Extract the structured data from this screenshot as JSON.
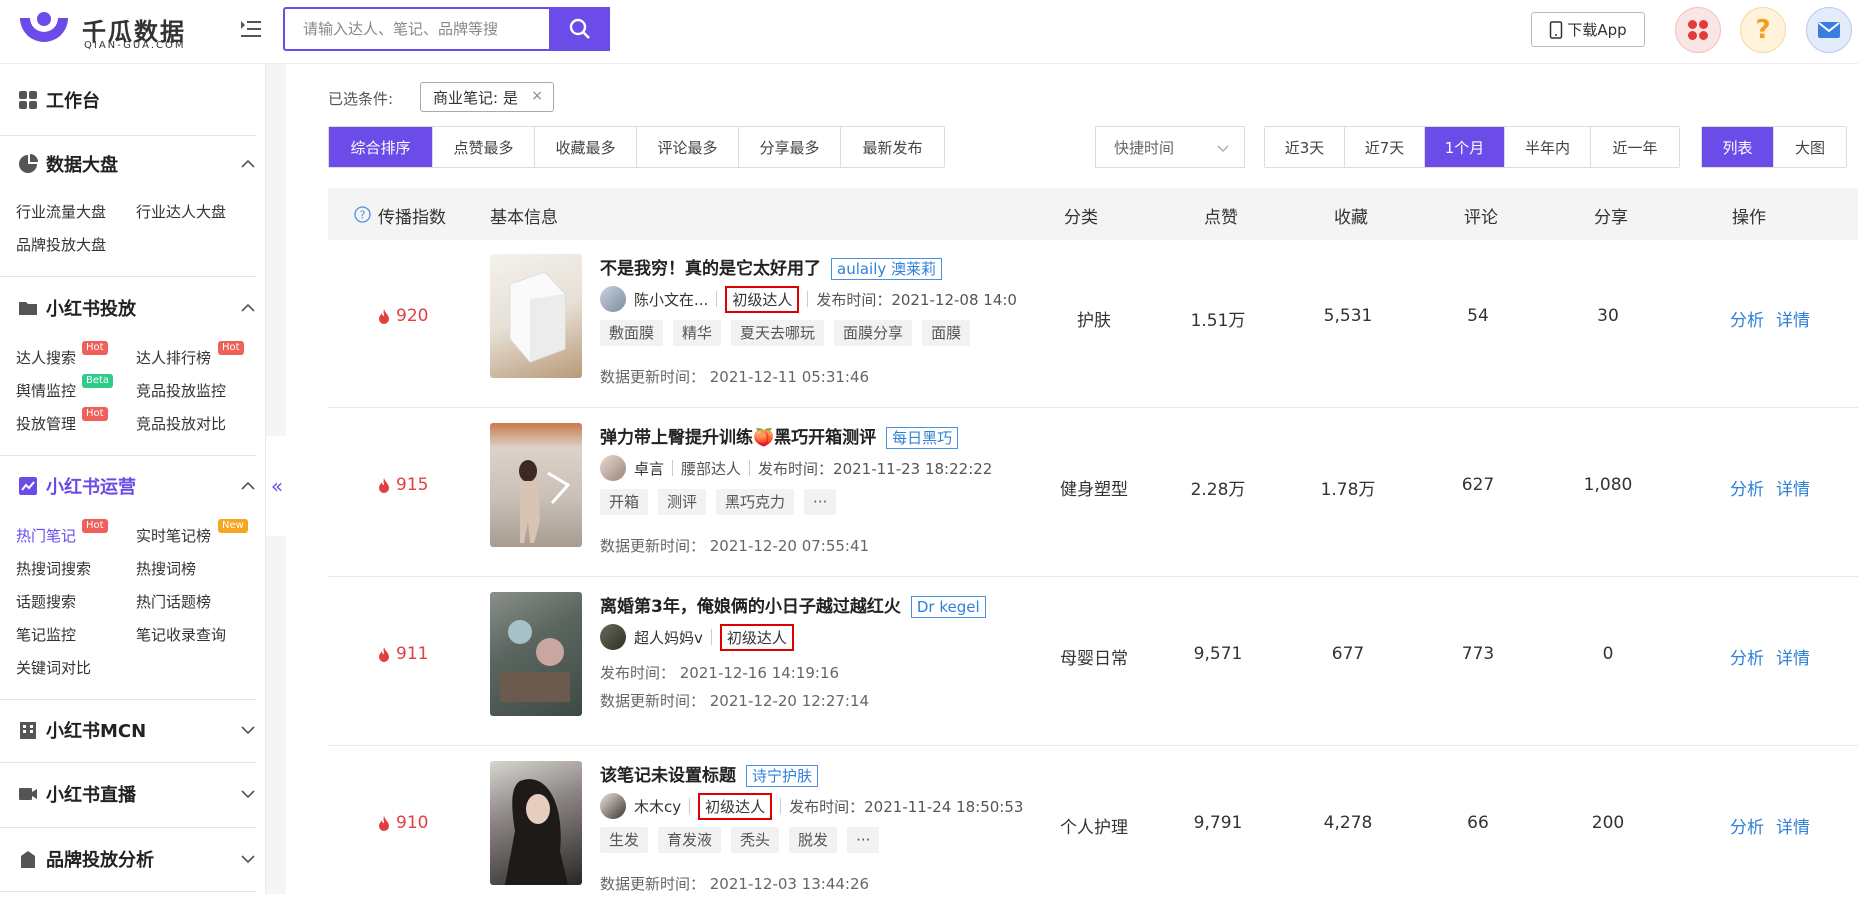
{
  "brand": {
    "name": "千瓜数据",
    "sub": "QIAN-GUA.COM",
    "color": "#6c4ce8"
  },
  "search": {
    "placeholder": "请输入达人、笔记、品牌等搜"
  },
  "header": {
    "download_label": "下载App"
  },
  "sidebar": {
    "workbench": "工作台",
    "sections": [
      {
        "title": "数据大盘",
        "items": [
          "行业流量大盘",
          "行业达人大盘",
          "品牌投放大盘"
        ]
      },
      {
        "title": "小红书投放",
        "items": [
          "达人搜索",
          "达人排行榜",
          "舆情监控",
          "竞品投放监控",
          "投放管理",
          "竞品投放对比"
        ]
      },
      {
        "title": "小红书运营",
        "items": [
          "热门笔记",
          "实时笔记榜",
          "热搜词搜索",
          "热搜词榜",
          "话题搜索",
          "热门话题榜",
          "笔记监控",
          "笔记收录查询",
          "关键词对比"
        ]
      },
      {
        "title": "小红书MCN"
      },
      {
        "title": "小红书直播"
      },
      {
        "title": "品牌投放分析"
      }
    ],
    "badges": {
      "hot": "Hot",
      "beta": "Beta",
      "new": "New"
    }
  },
  "filters": {
    "selected_label": "已选条件:",
    "selected_tag": "商业笔记: 是",
    "sort_tabs": [
      "综合排序",
      "点赞最多",
      "收藏最多",
      "评论最多",
      "分享最多",
      "最新发布"
    ],
    "sort_active": "综合排序",
    "quick_time": "快捷时间",
    "time_tabs": [
      "近3天",
      "近7天",
      "1个月",
      "半年内",
      "近一年"
    ],
    "time_active": "1个月",
    "view_tabs": [
      "列表",
      "大图"
    ],
    "view_active": "列表"
  },
  "table": {
    "headers": [
      "传播指数",
      "基本信息",
      "分类",
      "点赞",
      "收藏",
      "评论",
      "分享",
      "操作"
    ],
    "rows": [
      {
        "score": "920",
        "title": "不是我穷！真的是它太好用了",
        "brand": "aulaily 澳莱莉",
        "author": "陈小文在...",
        "level": "初级达人",
        "level_boxed": true,
        "publish": "发布时间：2021-12-08 14:0",
        "tags": [
          "敷面膜",
          "精华",
          "夏天去哪玩",
          "面膜分享",
          "面膜"
        ],
        "updated": "数据更新时间：  2021-12-11 05:31:46",
        "category": "护肤",
        "likes": "1.51万",
        "collects": "5,531",
        "comments": "54",
        "shares": "30",
        "ops": [
          "分析",
          "详情"
        ]
      },
      {
        "score": "915",
        "title": "弹力带上臀提升训练🍑黑巧开箱测评",
        "brand": "每日黑巧",
        "author": "卓言",
        "level": "腰部达人",
        "level_boxed": false,
        "publish": "发布时间：2021-11-23 18:22:22",
        "tags": [
          "开箱",
          "测评",
          "黑巧克力",
          "···"
        ],
        "updated": "数据更新时间：  2021-12-20 07:55:41",
        "category": "健身塑型",
        "likes": "2.28万",
        "collects": "1.78万",
        "comments": "627",
        "shares": "1,080",
        "ops": [
          "分析",
          "详情"
        ]
      },
      {
        "score": "911",
        "title": "离婚第3年，俺娘俩的小日子越过越红火",
        "brand": "Dr kegel",
        "author": "超人妈妈v",
        "level": "初级达人",
        "level_boxed": true,
        "publish": "发布时间：  2021-12-16 14:19:16",
        "tags": [],
        "updated": "数据更新时间：  2021-12-20 12:27:14",
        "category": "母婴日常",
        "likes": "9,571",
        "collects": "677",
        "comments": "773",
        "shares": "0",
        "ops": [
          "分析",
          "详情"
        ]
      },
      {
        "score": "910",
        "title": "该笔记未设置标题",
        "brand": "诗宁护肤",
        "author": "木木cy",
        "level": "初级达人",
        "level_boxed": true,
        "publish": "发布时间：2021-11-24 18:50:53",
        "tags": [
          "生发",
          "育发液",
          "秃头",
          "脱发",
          "···"
        ],
        "updated": "数据更新时间：  2021-12-03 13:44:26",
        "category": "个人护理",
        "likes": "9,791",
        "collects": "4,278",
        "comments": "66",
        "shares": "200",
        "ops": [
          "分析",
          "详情"
        ]
      }
    ]
  }
}
